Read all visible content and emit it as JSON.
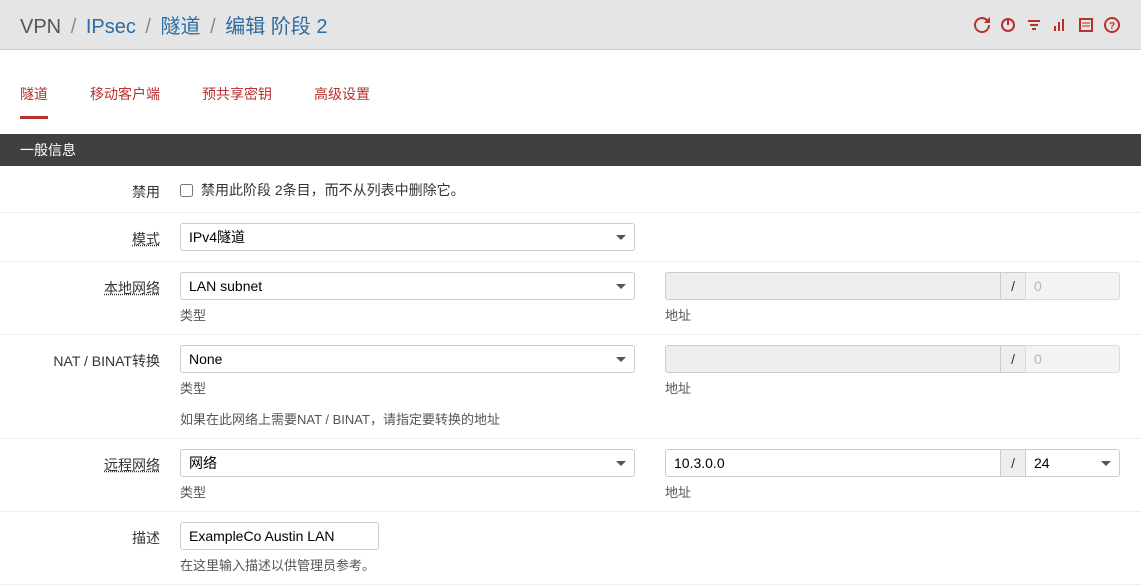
{
  "breadcrumb": {
    "vpn": "VPN",
    "ipsec": "IPsec",
    "tunnels": "隧道",
    "edit": "编辑 阶段 2"
  },
  "tabs": {
    "tunnels": "隧道",
    "mobile": "移动客户端",
    "psk": "预共享密钥",
    "advanced": "高级设置"
  },
  "section": {
    "general": "一般信息"
  },
  "labels": {
    "disabled": "禁用",
    "mode": "模式",
    "local_net": "本地网络",
    "nat_binat": "NAT / BINAT转换",
    "remote_net": "远程网络",
    "desc": "描述",
    "type": "类型",
    "address": "地址"
  },
  "fields": {
    "disabled_text": "禁用此阶段 2条目，而不从列表中删除它。",
    "mode_value": "IPv4隧道",
    "local_type": "LAN subnet",
    "local_addr": "",
    "local_cidr": "0",
    "nat_type": "None",
    "nat_addr": "",
    "nat_cidr": "0",
    "nat_help": "如果在此网络上需要NAT / BINAT，请指定要转换的地址",
    "remote_type": "网络",
    "remote_addr": "10.3.0.0",
    "remote_cidr": "24",
    "desc_value": "ExampleCo Austin LAN",
    "desc_help": "在这里输入描述以供管理员参考。"
  }
}
